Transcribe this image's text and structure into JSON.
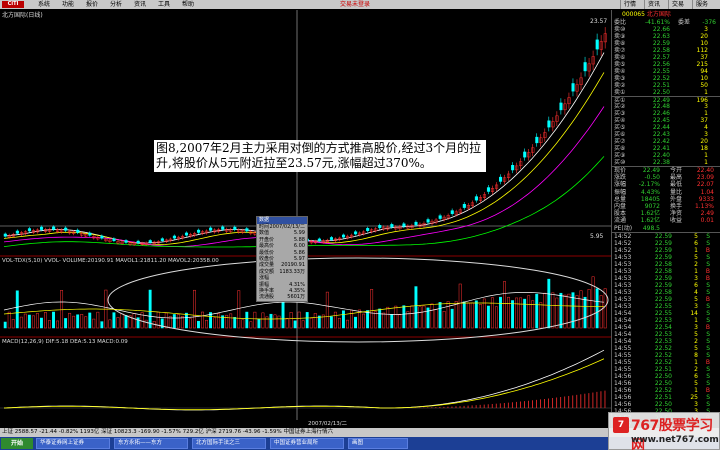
{
  "menubar": {
    "logo": "CITI",
    "items": [
      "系统",
      "功能",
      "报价",
      "分析",
      "资讯",
      "工具",
      "帮助"
    ],
    "center_text": "交易未登录",
    "right_buttons": [
      "行情",
      "资讯",
      "交易",
      "服务"
    ]
  },
  "chart": {
    "title": "北方国际(日线)",
    "price_tag": "23.57",
    "price_label_low": "5.95",
    "volume_label": "VOL-TDX(5,10)  VVOL-  VOLUME:20190.91  MAVOL1:21811.20  MAVOL2:20358.00",
    "macd_label": "MACD(12,26,9)  DIF:5.18  DEA:5.13  MACD:0.09",
    "date_label": "2007/02/13/二",
    "annotation": "图8,2007年2月主力采用对倒的方式推高股价,经过3个月的拉升,将股价从5元附近拉至23.57元,涨幅超过370%。"
  },
  "popup": {
    "title": "数据",
    "rows": [
      {
        "k": "时间",
        "v": "2007/02/13/二"
      },
      {
        "k": "数值",
        "v": "5.99"
      },
      {
        "k": "开盘价",
        "v": "5.88"
      },
      {
        "k": "最高价",
        "v": "6.00"
      },
      {
        "k": "最低价",
        "v": "5.86"
      },
      {
        "k": "收盘价",
        "v": "5.97"
      },
      {
        "k": "成交量",
        "v": "20190.91"
      },
      {
        "k": "成交额",
        "v": "1183.33万"
      },
      {
        "k": "涨幅",
        "v": ""
      },
      {
        "k": "振幅",
        "v": "4.31%"
      },
      {
        "k": "换手率",
        "v": "4.35%"
      },
      {
        "k": "流通股",
        "v": "5601万"
      }
    ]
  },
  "right_panel": {
    "code": "000065",
    "name": "北方国际",
    "weibi": {
      "label": "委比",
      "v1": "-41.61%",
      "v2": "委差",
      "v3": "-376"
    },
    "orderbook": [
      {
        "label": "卖⑩",
        "price": "22.66",
        "vol": "3"
      },
      {
        "label": "卖⑨",
        "price": "22.63",
        "vol": "20"
      },
      {
        "label": "卖⑧",
        "price": "22.59",
        "vol": "10"
      },
      {
        "label": "卖⑦",
        "price": "22.58",
        "vol": "112"
      },
      {
        "label": "卖⑥",
        "price": "22.57",
        "vol": "37"
      },
      {
        "label": "卖⑤",
        "price": "22.56",
        "vol": "215"
      },
      {
        "label": "卖④",
        "price": "22.55",
        "vol": "94"
      },
      {
        "label": "卖③",
        "price": "22.52",
        "vol": "10"
      },
      {
        "label": "卖②",
        "price": "22.51",
        "vol": "50"
      },
      {
        "label": "卖①",
        "price": "22.50",
        "vol": "1"
      },
      {
        "label": "买①",
        "price": "22.49",
        "vol": "196"
      },
      {
        "label": "买②",
        "price": "22.48",
        "vol": "3"
      },
      {
        "label": "买③",
        "price": "22.46",
        "vol": "1"
      },
      {
        "label": "买④",
        "price": "22.45",
        "vol": "37"
      },
      {
        "label": "买⑤",
        "price": "22.44",
        "vol": "4"
      },
      {
        "label": "买⑥",
        "price": "22.43",
        "vol": "3"
      },
      {
        "label": "买⑦",
        "price": "22.42",
        "vol": "20"
      },
      {
        "label": "买⑧",
        "price": "22.41",
        "vol": "18"
      },
      {
        "label": "买⑨",
        "price": "22.40",
        "vol": "1"
      },
      {
        "label": "买⑩",
        "price": "22.38",
        "vol": "1"
      }
    ],
    "stats": [
      {
        "a": "现价",
        "b": "22.49",
        "c": "今开",
        "d": "22.40"
      },
      {
        "a": "涨跌",
        "b": "-0.50",
        "c": "最高",
        "d": "23.09"
      },
      {
        "a": "涨幅",
        "b": "-2.17%",
        "c": "最低",
        "d": "22.07"
      },
      {
        "a": "振幅",
        "b": "4.43%",
        "c": "量比",
        "d": "1.04"
      },
      {
        "a": "总量",
        "b": "18405",
        "c": "外盘",
        "d": "9333"
      },
      {
        "a": "内盘",
        "b": "9072",
        "c": "换手",
        "d": "1.13%"
      },
      {
        "a": "股本",
        "b": "1.62亿",
        "c": "净资",
        "d": "2.49"
      },
      {
        "a": "流通",
        "b": "1.62亿",
        "c": "收益",
        "d": "0.01"
      },
      {
        "a": "PE(动)",
        "b": "498.5",
        "c": "",
        "d": ""
      }
    ],
    "ticks": [
      {
        "t": "14:52",
        "p": "22.59",
        "v": "5",
        "d": "S"
      },
      {
        "t": "14:52",
        "p": "22.59",
        "v": "6",
        "d": "S"
      },
      {
        "t": "14:52",
        "p": "22.59",
        "v": "1",
        "d": "B"
      },
      {
        "t": "14:53",
        "p": "22.59",
        "v": "5",
        "d": "S"
      },
      {
        "t": "14:53",
        "p": "22.58",
        "v": "2",
        "d": "S"
      },
      {
        "t": "14:53",
        "p": "22.58",
        "v": "1",
        "d": "B"
      },
      {
        "t": "14:53",
        "p": "22.59",
        "v": "3",
        "d": "B"
      },
      {
        "t": "14:53",
        "p": "22.59",
        "v": "6",
        "d": "S"
      },
      {
        "t": "14:53",
        "p": "22.58",
        "v": "4",
        "d": "S"
      },
      {
        "t": "14:53",
        "p": "22.59",
        "v": "5",
        "d": "B"
      },
      {
        "t": "14:53",
        "p": "22.55",
        "v": "3",
        "d": "S"
      },
      {
        "t": "14:54",
        "p": "22.55",
        "v": "14",
        "d": "S"
      },
      {
        "t": "14:54",
        "p": "22.53",
        "v": "1",
        "d": "S"
      },
      {
        "t": "14:54",
        "p": "22.54",
        "v": "3",
        "d": "B"
      },
      {
        "t": "14:54",
        "p": "22.53",
        "v": "5",
        "d": "S"
      },
      {
        "t": "14:54",
        "p": "22.53",
        "v": "2",
        "d": "S"
      },
      {
        "t": "14:55",
        "p": "22.52",
        "v": "5",
        "d": "S"
      },
      {
        "t": "14:55",
        "p": "22.52",
        "v": "8",
        "d": "S"
      },
      {
        "t": "14:55",
        "p": "22.52",
        "v": "1",
        "d": "B"
      },
      {
        "t": "14:55",
        "p": "22.51",
        "v": "2",
        "d": "S"
      },
      {
        "t": "14:56",
        "p": "22.50",
        "v": "6",
        "d": "S"
      },
      {
        "t": "14:56",
        "p": "22.50",
        "v": "5",
        "d": "S"
      },
      {
        "t": "14:56",
        "p": "22.52",
        "v": "1",
        "d": "B"
      },
      {
        "t": "14:56",
        "p": "22.51",
        "v": "25",
        "d": "S"
      },
      {
        "t": "14:56",
        "p": "22.50",
        "v": "3",
        "d": "S"
      },
      {
        "t": "14:56",
        "p": "22.50",
        "v": "3",
        "d": "S"
      },
      {
        "t": "14:57",
        "p": "22.51",
        "v": "2",
        "d": "B"
      },
      {
        "t": "14:57",
        "p": "22.50",
        "v": "5",
        "d": "S"
      },
      {
        "t": "14:57",
        "p": "22.49",
        "v": "6",
        "d": "S"
      },
      {
        "t": "14:57",
        "p": "22.49",
        "v": "1",
        "d": "S"
      },
      {
        "t": "14:57",
        "p": "22.49",
        "v": "4",
        "d": "S"
      },
      {
        "t": "14:58",
        "p": "22.49",
        "v": "5",
        "d": "S"
      }
    ]
  },
  "statusbar": "上证 2588.57  -21.44  -0.82%  1193亿  深证 10823.3  -169.90  -1.57%  729.2亿  沪深 2719.76  -43.96  -1.59%  中国证券上海行情六",
  "taskbar": {
    "start": "开始",
    "tasks": [
      "华泰证券网上证券",
      "东方永拓——东方",
      "北方国际手法之三",
      "中国证券营业局所",
      "画图"
    ]
  },
  "watermark": {
    "logo": "7",
    "name": "767股票学习网",
    "url": "www.net767.com"
  },
  "colors": {
    "up": "#ff3030",
    "down": "#00ffff",
    "ma5": "#ffffff",
    "ma10": "#ffff00",
    "ma20": "#ff00ff",
    "ma60": "#00ff00"
  }
}
